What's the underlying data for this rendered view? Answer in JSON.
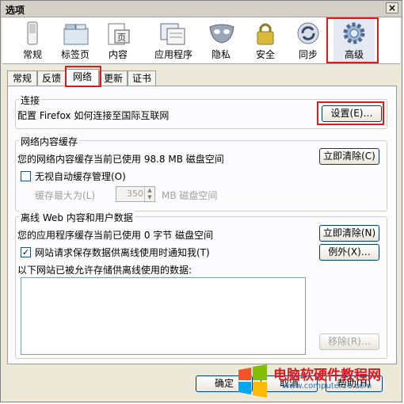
{
  "window": {
    "title": "选项",
    "close": "×"
  },
  "toolbar": [
    {
      "label": "常规",
      "icon": "switch-icon"
    },
    {
      "label": "标签页",
      "icon": "tabs-icon"
    },
    {
      "label": "内容",
      "icon": "page-icon"
    },
    {
      "label": "应用程序",
      "icon": "applications-icon"
    },
    {
      "label": "隐私",
      "icon": "mask-icon"
    },
    {
      "label": "安全",
      "icon": "lock-icon"
    },
    {
      "label": "同步",
      "icon": "sync-icon"
    },
    {
      "label": "高级",
      "icon": "gear-icon"
    }
  ],
  "tabs": [
    "常规",
    "反馈",
    "网络",
    "更新",
    "证书"
  ],
  "connection": {
    "title": "连接",
    "desc": "配置 Firefox 如何连接至国际互联网",
    "settings_button": "设置(E)…"
  },
  "cache": {
    "title": "网络内容缓存",
    "usage": "您的网络内容缓存当前已使用 98.8 MB 磁盘空间",
    "clear_button": "立即清除(C)",
    "override_label": "无视自动缓存管理(O)",
    "limit_label": "缓存最大为(L)",
    "limit_value": "350",
    "limit_unit": "MB 磁盘空间"
  },
  "offline": {
    "title": "离线 Web 内容和用户数据",
    "usage": "您的应用程序缓存当前已使用 0 字节 磁盘空间",
    "clear_button": "立即清除(N)",
    "notify_label": "网站请求保存数据供离线使用时通知我(T)",
    "exceptions_button": "例外(X)…",
    "list_label": "以下网站已被允许存储供离线使用的数据:",
    "remove_button": "移除(R)…"
  },
  "bottom": {
    "ok": "确定",
    "cancel": "取消",
    "help": "帮助(H)"
  },
  "watermark": {
    "title": "电脑软硬件教程网",
    "url": "www.computer26.com"
  },
  "colors": {
    "highlight": "#e01a1a",
    "accent": "#003c74"
  }
}
